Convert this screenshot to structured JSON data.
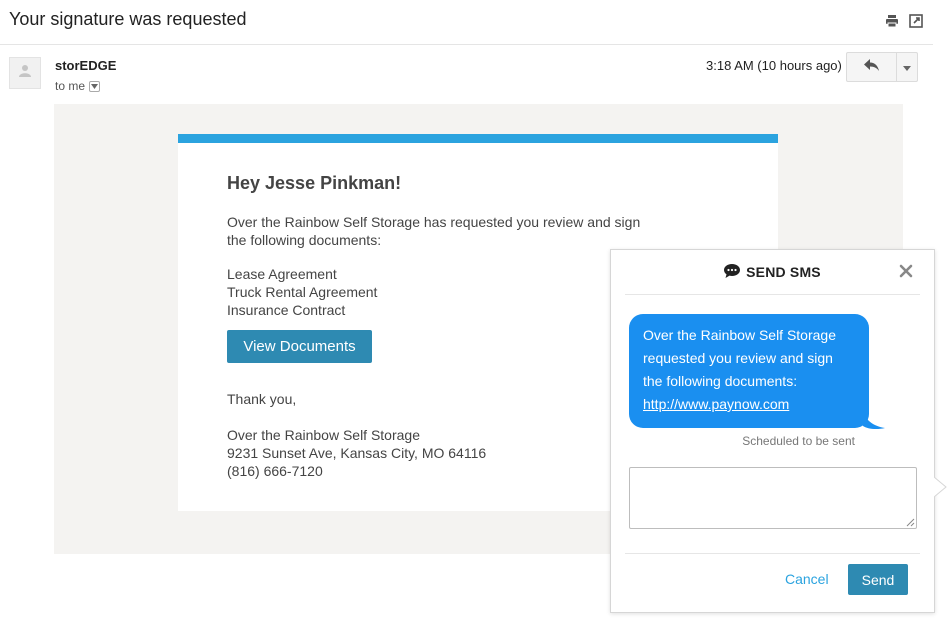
{
  "email": {
    "subject": "Your signature was requested",
    "sender": "storEDGE",
    "to": "to me",
    "time": "3:18 AM (10 hours ago)"
  },
  "message": {
    "greeting": "Hey Jesse Pinkman!",
    "intro": "Over the Rainbow Self Storage has requested you review and sign the following documents:",
    "documents": [
      "Lease Agreement",
      "Truck Rental Agreement",
      "Insurance Contract"
    ],
    "button_label": "View Documents",
    "thanks": "Thank you,",
    "company_name": "Over the Rainbow Self Storage",
    "address": "9231 Sunset Ave, Kansas City, MO 64116",
    "phone": "(816) 666-7120",
    "accent_color": "#2ba3df"
  },
  "sms": {
    "title": "SEND SMS",
    "bubble_text": "Over the Rainbow Self Storage requested you review and sign the following documents:",
    "bubble_link": "http://www.paynow.com",
    "scheduled": "Scheduled to be sent",
    "input_value": "",
    "cancel_label": "Cancel",
    "send_label": "Send",
    "bubble_color": "#1a8ff0"
  },
  "icons": [
    "print-icon",
    "new-window-icon",
    "avatar-icon",
    "reply-icon",
    "more-options-icon",
    "chat-bubble-icon",
    "close-icon"
  ]
}
